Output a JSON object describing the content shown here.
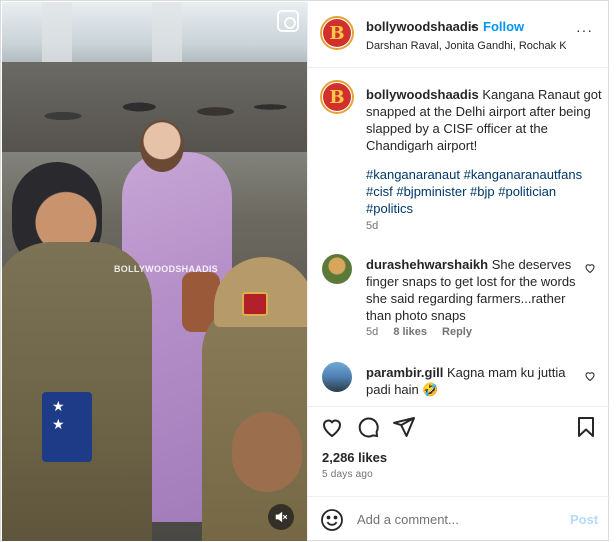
{
  "post": {
    "watermark": "BOLLYWOODSHAADIS",
    "mute_icon": "speaker-muted"
  },
  "header": {
    "username": "bollywoodshaadis",
    "separator": "•",
    "follow_label": "Follow",
    "tagged": "Darshan Raval, Jonita Gandhi, Rochak K...",
    "more_label": "···"
  },
  "caption": {
    "username": "bollywoodshaadis",
    "text": "Kangana Ranaut got snapped at the Delhi airport after being slapped by a CISF officer at the Chandigarh airport!",
    "hashtags": "#kanganaranaut #kanganaranautfans #cisf #bjpminister #bjp #politician #politics",
    "time": "5d"
  },
  "comments": [
    {
      "username": "durashehwarshaikh",
      "text": "She deserves finger snaps to get lost for the words she said regarding farmers...rather than photo snaps",
      "time": "5d",
      "likes": "8 likes",
      "reply": "Reply"
    },
    {
      "username": "parambir.gill",
      "text": "Kagna mam ku juttia padi hain 🤣"
    }
  ],
  "stats": {
    "likes": "2,286 likes",
    "ago": "5 days ago"
  },
  "add_comment": {
    "placeholder": "Add a comment...",
    "post_label": "Post"
  },
  "colors": {
    "link_blue": "#0095f6",
    "hashtag_blue": "#00376b",
    "muted_text": "#737373",
    "post_disabled": "#b3dbff"
  }
}
